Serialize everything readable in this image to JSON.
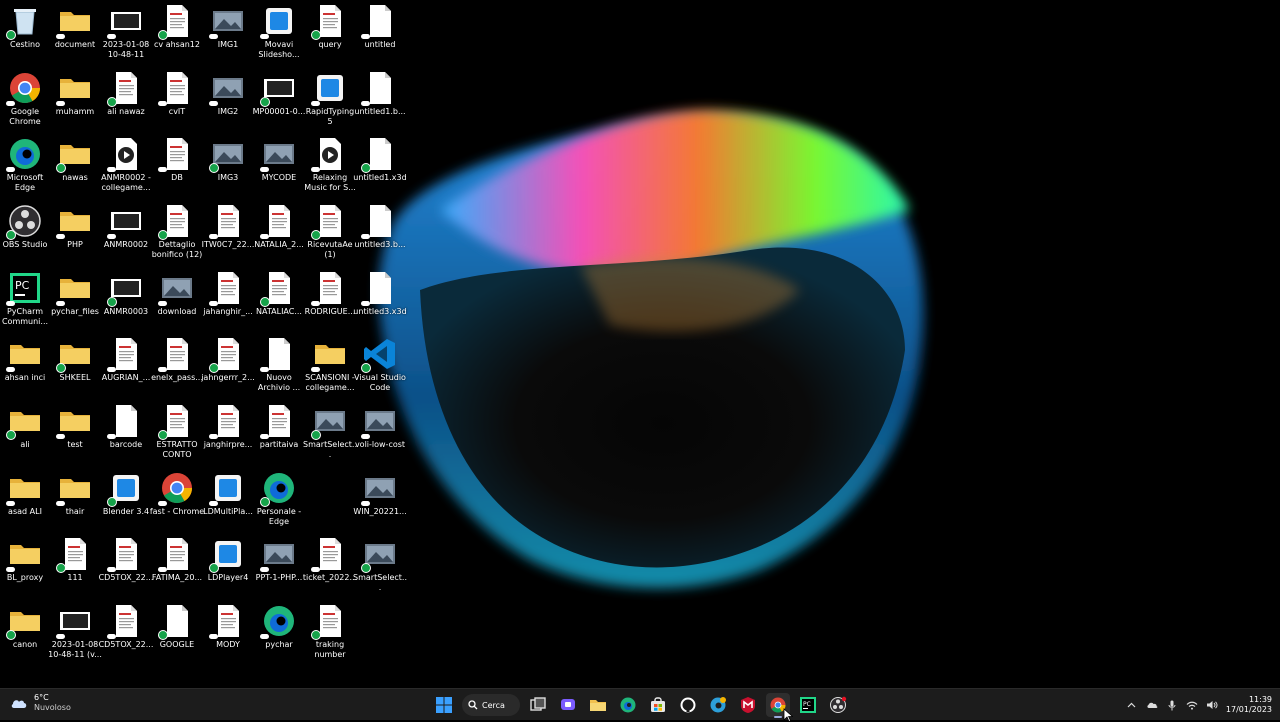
{
  "desktop": {
    "icons": [
      {
        "label": "Cestino",
        "kind": "recycle-bin-icon"
      },
      {
        "label": "document",
        "kind": "folder-icon"
      },
      {
        "label": "2023-01-08 10-48-11",
        "kind": "video-file-icon"
      },
      {
        "label": "cv ahsan12",
        "kind": "document-icon"
      },
      {
        "label": "IMG1",
        "kind": "image-file-icon"
      },
      {
        "label": "Movavi Slidesho...",
        "kind": "app-icon"
      },
      {
        "label": "query",
        "kind": "document-icon"
      },
      {
        "label": "untitled",
        "kind": "file-icon"
      },
      {
        "label": "Google Chrome",
        "kind": "chrome-icon"
      },
      {
        "label": "muhamm",
        "kind": "folder-icon"
      },
      {
        "label": "ali nawaz",
        "kind": "document-icon"
      },
      {
        "label": "cvIT",
        "kind": "document-icon"
      },
      {
        "label": "IMG2",
        "kind": "image-file-icon"
      },
      {
        "label": "MP00001-0...",
        "kind": "video-file-icon"
      },
      {
        "label": "RapidTyping 5",
        "kind": "app-icon"
      },
      {
        "label": "untitled1.b...",
        "kind": "file-icon"
      },
      {
        "label": "Microsoft Edge",
        "kind": "edge-icon"
      },
      {
        "label": "nawas",
        "kind": "folder-icon"
      },
      {
        "label": "ANMR0002 - collegame...",
        "kind": "media-file-icon"
      },
      {
        "label": "DB",
        "kind": "document-icon"
      },
      {
        "label": "IMG3",
        "kind": "image-file-icon"
      },
      {
        "label": "MYCODE",
        "kind": "image-file-icon"
      },
      {
        "label": "Relaxing Music for S...",
        "kind": "media-file-icon"
      },
      {
        "label": "untitled1.x3d",
        "kind": "file-icon"
      },
      {
        "label": "OBS Studio",
        "kind": "obs-icon"
      },
      {
        "label": "PHP",
        "kind": "folder-icon"
      },
      {
        "label": "ANMR0002",
        "kind": "video-file-icon"
      },
      {
        "label": "Dettaglio bonifico (12)",
        "kind": "document-icon"
      },
      {
        "label": "ITW0C7_22...",
        "kind": "document-icon"
      },
      {
        "label": "NATALIA_2...",
        "kind": "document-icon"
      },
      {
        "label": "RicevutaAe (1)",
        "kind": "document-icon"
      },
      {
        "label": "untitled3.b...",
        "kind": "file-icon"
      },
      {
        "label": "PyCharm Communi...",
        "kind": "pycharm-icon"
      },
      {
        "label": "pychar_files",
        "kind": "folder-icon"
      },
      {
        "label": "ANMR0003",
        "kind": "video-file-icon"
      },
      {
        "label": "download",
        "kind": "image-file-icon"
      },
      {
        "label": "jahanghir_...",
        "kind": "document-icon"
      },
      {
        "label": "NATALIAC...",
        "kind": "document-icon"
      },
      {
        "label": "RODRIGUE...",
        "kind": "document-icon"
      },
      {
        "label": "untitled3.x3d",
        "kind": "file-icon"
      },
      {
        "label": "ahsan inci",
        "kind": "folder-icon"
      },
      {
        "label": "SHKEEL",
        "kind": "folder-icon"
      },
      {
        "label": "AUGRIAN_...",
        "kind": "document-icon"
      },
      {
        "label": "enelx_pass...",
        "kind": "document-icon"
      },
      {
        "label": "jahngerrr_2...",
        "kind": "document-icon"
      },
      {
        "label": "Nuovo Archivio ...",
        "kind": "file-icon"
      },
      {
        "label": "SCANSIONI - collegame...",
        "kind": "folder-icon"
      },
      {
        "label": "Visual Studio Code",
        "kind": "vscode-icon"
      },
      {
        "label": "ali",
        "kind": "folder-icon"
      },
      {
        "label": "test",
        "kind": "folder-icon"
      },
      {
        "label": "barcode",
        "kind": "file-icon"
      },
      {
        "label": "ESTRATTO CONTO",
        "kind": "document-icon"
      },
      {
        "label": "janghirpre...",
        "kind": "document-icon"
      },
      {
        "label": "partitaiva",
        "kind": "document-icon"
      },
      {
        "label": "SmartSelect...",
        "kind": "image-file-icon"
      },
      {
        "label": "voli-low-cost",
        "kind": "image-file-icon"
      },
      {
        "label": "asad ALI",
        "kind": "folder-icon"
      },
      {
        "label": "thair",
        "kind": "folder-icon"
      },
      {
        "label": "Blender 3.4",
        "kind": "app-icon"
      },
      {
        "label": "fast - Chrome",
        "kind": "chrome-icon"
      },
      {
        "label": "LDMultiPla...",
        "kind": "app-icon"
      },
      {
        "label": "Personale - Edge",
        "kind": "edge-icon"
      },
      {
        "label": "WIN_20221...",
        "kind": "image-file-icon"
      },
      {
        "label": "BL_proxy",
        "kind": "folder-icon"
      },
      {
        "label": "111",
        "kind": "document-icon"
      },
      {
        "label": "CD5TOX_22...",
        "kind": "document-icon"
      },
      {
        "label": "FATIMA_20...",
        "kind": "document-icon"
      },
      {
        "label": "LDPlayer4",
        "kind": "app-icon"
      },
      {
        "label": "PPT-1-PHP...",
        "kind": "image-file-icon"
      },
      {
        "label": "ticket_2022...",
        "kind": "document-icon"
      },
      {
        "label": "SmartSelect...",
        "kind": "image-file-icon"
      },
      {
        "label": "canon",
        "kind": "folder-icon"
      },
      {
        "label": "2023-01-08 10-48-11 (v...",
        "kind": "video-file-icon"
      },
      {
        "label": "CD5TOX_22...",
        "kind": "document-icon"
      },
      {
        "label": "GOOGLE",
        "kind": "file-icon"
      },
      {
        "label": "MODY",
        "kind": "document-icon"
      },
      {
        "label": "pychar",
        "kind": "edge-icon"
      },
      {
        "label": "traking number",
        "kind": "document-icon"
      }
    ]
  },
  "taskbar": {
    "weather": {
      "temp": "6°C",
      "condition": "Nuvoloso",
      "icon": "cloud-icon"
    },
    "search_label": "Cerca",
    "apps": [
      {
        "name": "start-button",
        "icon": "windows-icon"
      },
      {
        "name": "task-view-button",
        "icon": "task-view-icon"
      },
      {
        "name": "teams-chat-button",
        "icon": "chat-icon"
      },
      {
        "name": "file-explorer-button",
        "icon": "folder-icon"
      },
      {
        "name": "edge-taskbar-button",
        "icon": "edge-icon"
      },
      {
        "name": "store-button",
        "icon": "store-icon"
      },
      {
        "name": "github-button",
        "icon": "github-icon"
      },
      {
        "name": "edge-beta-button",
        "icon": "edge-beta-icon"
      },
      {
        "name": "mcafee-button",
        "icon": "mcafee-icon"
      },
      {
        "name": "chrome-taskbar-button",
        "icon": "chrome-icon",
        "active": true
      },
      {
        "name": "pycharm-taskbar-button",
        "icon": "pycharm-icon"
      },
      {
        "name": "obs-taskbar-button",
        "icon": "obs-icon"
      }
    ],
    "clock": {
      "time": "11:39",
      "date": "17/01/2023"
    }
  },
  "colors": {
    "taskbar_bg": "#1c1c1c",
    "folder": "#f2c14e",
    "accent": "#0078d4"
  }
}
